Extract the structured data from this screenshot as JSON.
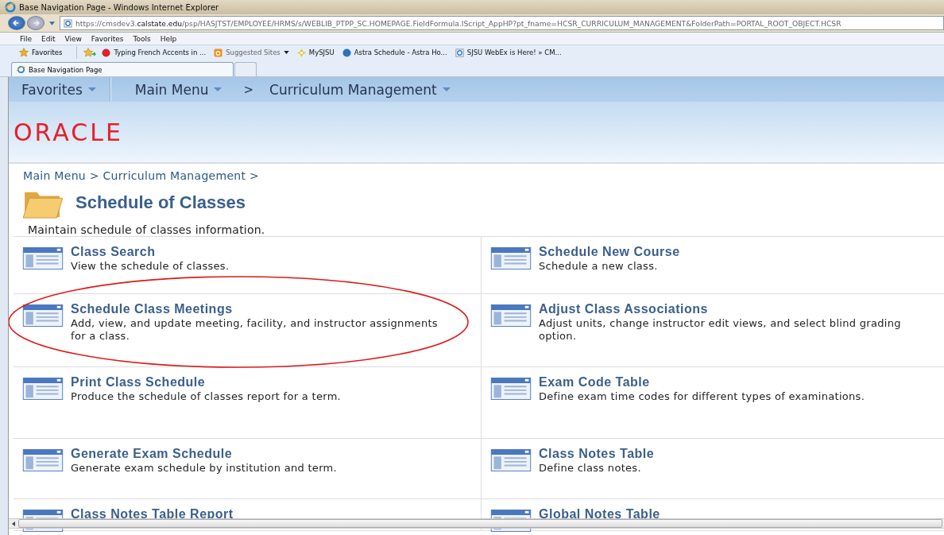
{
  "window": {
    "title": "Base Navigation Page - Windows Internet Explorer"
  },
  "address_bar": {
    "url_prefix": "https://cmsdev3.",
    "url_domain": "calstate.edu",
    "url_rest": "/psp/HASJTST/EMPLOYEE/HRMS/s/WEBLIB_PTPP_SC.HOMEPAGE.FieldFormula.IScript_AppHP?pt_fname=HCSR_CURRICULUM_MANAGEMENT&FolderPath=PORTAL_ROOT_OBJECT.HCSR"
  },
  "menu_bar": [
    "File",
    "Edit",
    "View",
    "Favorites",
    "Tools",
    "Help"
  ],
  "favorites_bar": {
    "favorites_label": "Favorites",
    "links": [
      {
        "label": "Typing French Accents in ...",
        "kind": "dot"
      },
      {
        "label": "Suggested Sites",
        "kind": "suggested"
      },
      {
        "label": "MySJSU",
        "kind": "sun"
      },
      {
        "label": "Astra Schedule - Astra Ho...",
        "kind": "globe"
      },
      {
        "label": "SJSU WebEx is Here! » CM...",
        "kind": "page"
      }
    ]
  },
  "tabs": [
    {
      "label": "Base Navigation Page",
      "selected": true
    },
    {
      "selected": false
    }
  ],
  "nav": {
    "favorites": "Favorites",
    "main_menu": "Main Menu",
    "separator": ">",
    "current": "Curriculum Management"
  },
  "logo": "ORACLE",
  "breadcrumb": "Main Menu > Curriculum Management >",
  "heading": "Schedule of Classes",
  "description": "Maintain schedule of classes information.",
  "items": [
    {
      "title": "Class Search",
      "text": "View the schedule of classes.",
      "highlighted": false
    },
    {
      "title": "Schedule New Course",
      "text": "Schedule a new class.",
      "highlighted": false
    },
    {
      "title": "Schedule Class Meetings",
      "text": "Add, view, and update meeting, facility, and instructor assignments for a class.",
      "highlighted": true
    },
    {
      "title": "Adjust Class Associations",
      "text": "Adjust units, change instructor edit views, and select blind grading option.",
      "highlighted": false
    },
    {
      "title": "Print Class Schedule",
      "text": "Produce the schedule of classes report for a term.",
      "highlighted": false
    },
    {
      "title": "Exam Code Table",
      "text": "Define exam time codes for different types of examinations.",
      "highlighted": false
    },
    {
      "title": "Generate Exam Schedule",
      "text": "Generate exam schedule by institution and term.",
      "highlighted": false
    },
    {
      "title": "Class Notes Table",
      "text": "Define class notes.",
      "highlighted": false
    },
    {
      "title": "Class Notes Table Report",
      "highlighted": false
    },
    {
      "title": "Global Notes Table",
      "highlighted": false
    }
  ]
}
